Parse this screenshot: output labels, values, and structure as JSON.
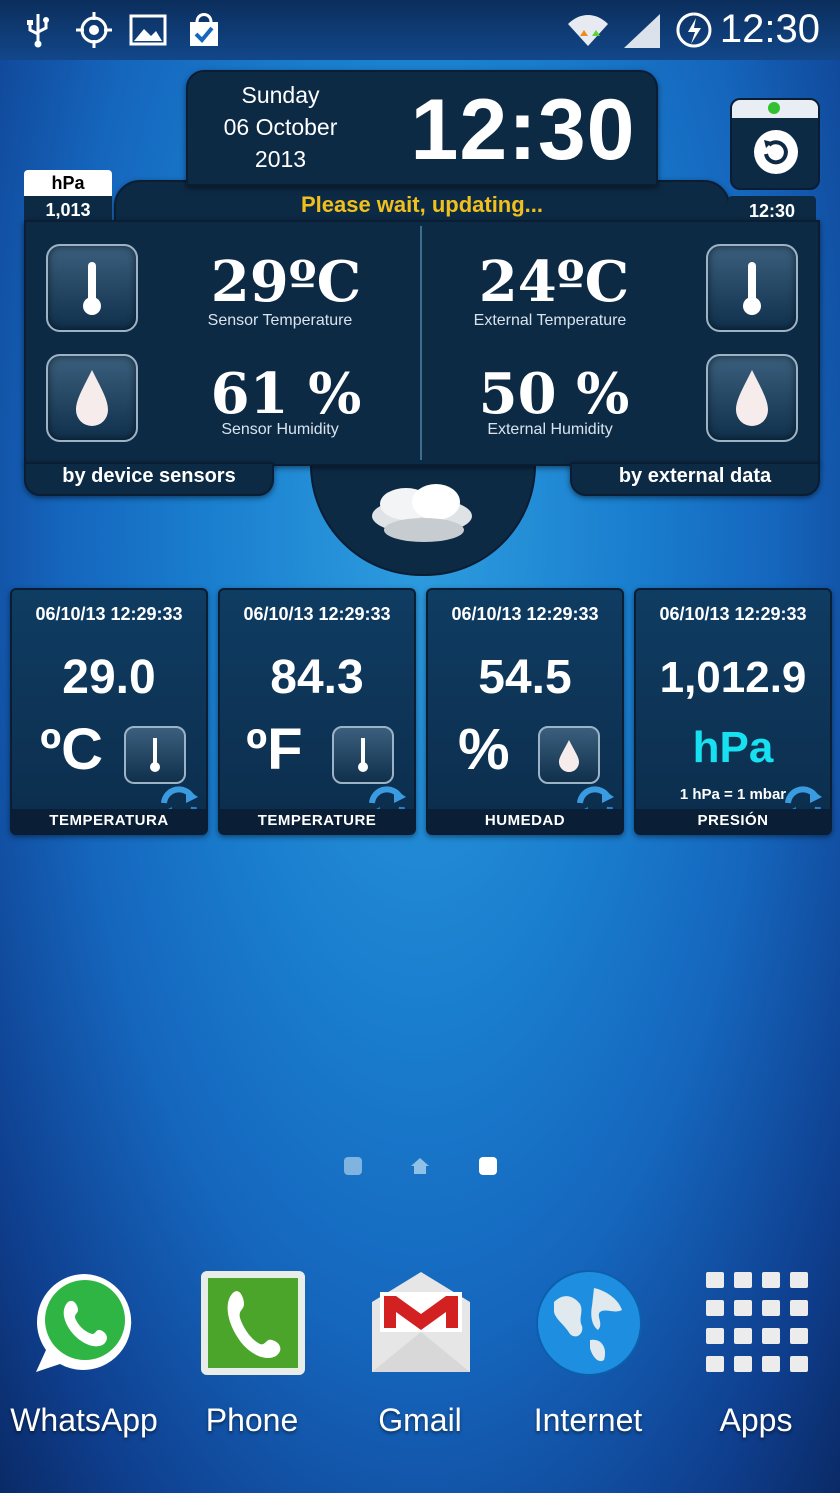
{
  "status_bar": {
    "time": "12:30",
    "left_icons": [
      "usb-icon",
      "gps-icon",
      "gallery-icon",
      "shopping-bag-icon"
    ],
    "right_icons": [
      "wifi-icon",
      "signal-icon",
      "battery-charging-icon"
    ]
  },
  "clock_widget": {
    "day": "Sunday",
    "date": "06 October",
    "year": "2013",
    "time": "12:30",
    "status": "Please wait, updating...",
    "pressure_unit": "hPa",
    "pressure_value": "1,013",
    "update_time": "12:30",
    "sensor_temp": "29ºC",
    "sensor_temp_label": "Sensor Temperature",
    "sensor_humidity": "61 %",
    "sensor_humidity_label": "Sensor Humidity",
    "external_temp": "24ºC",
    "external_temp_label": "External Temperature",
    "external_humidity": "50 %",
    "external_humidity_label": "External Humidity",
    "left_footer": "by device sensors",
    "right_footer": "by external data",
    "weather_icon": "cloud-icon"
  },
  "mini_widgets": [
    {
      "timestamp": "06/10/13 12:29:33",
      "value": "29.0",
      "unit": "ºC",
      "footer": "TEMPERATURA",
      "icon": "thermometer-icon"
    },
    {
      "timestamp": "06/10/13 12:29:33",
      "value": "84.3",
      "unit": "ºF",
      "footer": "TEMPERATURE",
      "icon": "thermometer-icon"
    },
    {
      "timestamp": "06/10/13 12:29:33",
      "value": "54.5",
      "unit": "%",
      "footer": "HUMEDAD",
      "icon": "drop-icon"
    },
    {
      "timestamp": "06/10/13 12:29:33",
      "value": "1,012.9",
      "unit": "hPa",
      "note": "1 hPa = 1 mbar",
      "footer": "PRESIÓN"
    }
  ],
  "pager": {
    "pages": 3,
    "current": 3
  },
  "dock": [
    {
      "label": "WhatsApp",
      "icon": "whatsapp-icon"
    },
    {
      "label": "Phone",
      "icon": "phone-icon"
    },
    {
      "label": "Gmail",
      "icon": "gmail-icon"
    },
    {
      "label": "Internet",
      "icon": "globe-icon"
    },
    {
      "label": "Apps",
      "icon": "apps-grid-icon"
    }
  ],
  "colors": {
    "accent_yellow": "#f2c01c",
    "hpa_cyan": "#17e0f0",
    "panel": "#0d2a45"
  }
}
